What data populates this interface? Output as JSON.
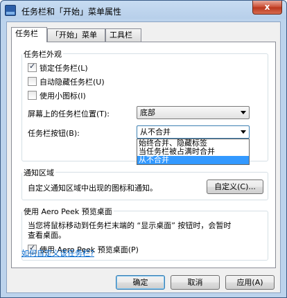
{
  "window": {
    "title": "任务栏和「开始」菜单属性",
    "close_label": "x"
  },
  "tabs": [
    {
      "label": "任务栏",
      "active": true
    },
    {
      "label": "「开始」菜单",
      "active": false
    },
    {
      "label": "工具栏",
      "active": false
    }
  ],
  "appearance": {
    "title": "任务栏外观",
    "lock": {
      "label": "锁定任务栏(L)",
      "checked": true
    },
    "autohide": {
      "label": "自动隐藏任务栏(U)",
      "checked": false
    },
    "small_icons": {
      "label": "使用小图标(I)",
      "checked": false
    },
    "location": {
      "label": "屏幕上的任务栏位置(T):",
      "value": "底部"
    },
    "buttons": {
      "label": "任务栏按钮(B):",
      "value": "从不合并",
      "options": [
        "始终合并、隐藏标签",
        "当任务栏被占满时合并",
        "从不合并"
      ]
    }
  },
  "notification": {
    "title": "通知区域",
    "description": "自定义通知区域中出现的图标和通知。",
    "customize_button": "自定义(C)..."
  },
  "aero": {
    "title": "使用 Aero Peek 预览桌面",
    "description_line1": "当您将鼠标移动到任务栏末端的 “显示桌面” 按钮时，会暂时",
    "description_line2": "查看桌面。",
    "checkbox": {
      "label": "使用 Aero Peek 预览桌面(P)",
      "checked": true
    }
  },
  "help_link": "如何自定义该任务栏?",
  "footer": {
    "ok": "确定",
    "cancel": "取消",
    "apply": "应用(A)"
  }
}
